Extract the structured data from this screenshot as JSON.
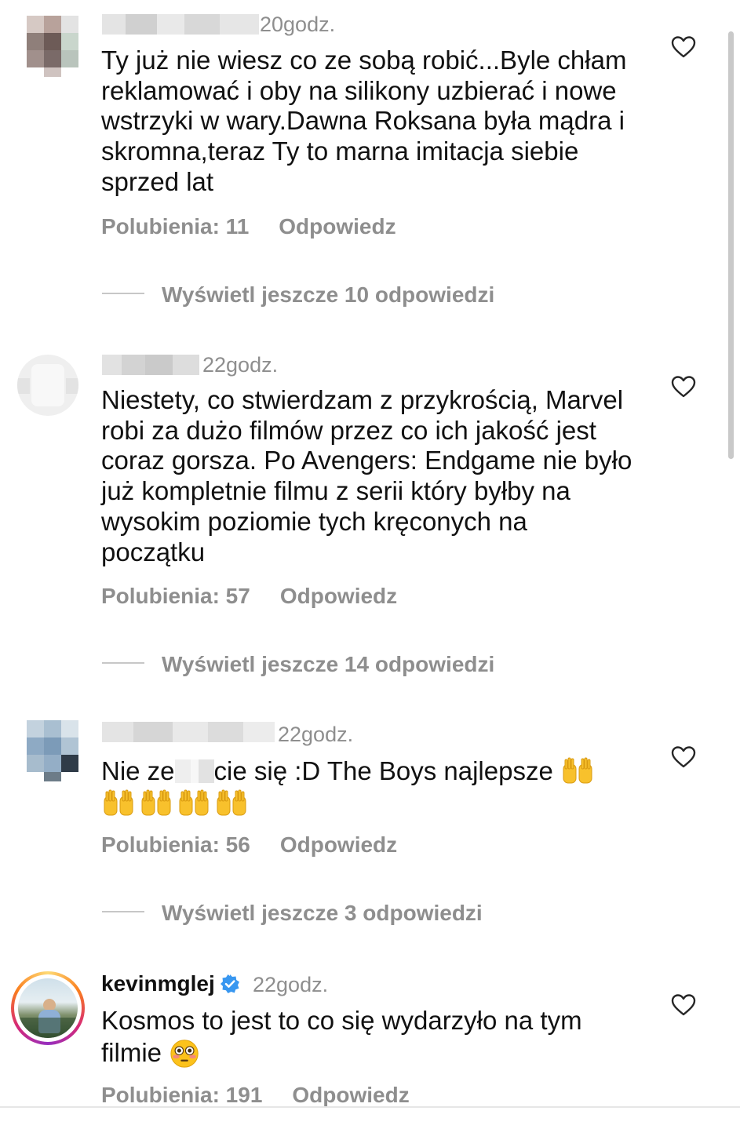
{
  "comments": [
    {
      "time": "20godz.",
      "text": "Ty już nie wiesz co ze sobą robić...Byle chłam reklamować i oby na silikony uzbierać i nowe wstrzyki w wary.Dawna Roksana była mądra i skromna,teraz Ty to marna imitacja siebie sprzed lat",
      "likes": "Polubienia: 11",
      "reply": "Odpowiedz",
      "more": "Wyświetl jeszcze 10 odpowiedzi"
    },
    {
      "time": "22godz.",
      "text": "Niestety, co stwierdzam z przykrością, Marvel robi za dużo filmów przez co ich jakość jest coraz gorsza. Po Avengers: Endgame nie było już kompletnie filmu z serii który byłby na wysokim poziomie tych kręconych na początku",
      "likes": "Polubienia: 57",
      "reply": "Odpowiedz",
      "more": "Wyświetl jeszcze 14 odpowiedzi"
    },
    {
      "time": "22godz.",
      "text_part1": "Nie ze",
      "text_part2": "cie się :D The Boys najlepsze",
      "likes": "Polubienia: 56",
      "reply": "Odpowiedz",
      "more": "Wyświetl jeszcze 3 odpowiedzi"
    },
    {
      "username": "kevinmglej",
      "time": "22godz.",
      "text": "Kosmos to jest to co się wydarzyło na tym filmie",
      "likes": "Polubienia: 191",
      "reply": "Odpowiedz"
    }
  ],
  "icons": {
    "heart": "heart-outline-icon",
    "verified": "verified-badge-icon",
    "emoji_raised_hands": "raising-hands-emoji",
    "emoji_flushed": "flushed-face-emoji"
  },
  "colors": {
    "meta_gray": "#8e8e8e",
    "verified_blue": "#3897f0",
    "story_ring": "#e1306c"
  }
}
